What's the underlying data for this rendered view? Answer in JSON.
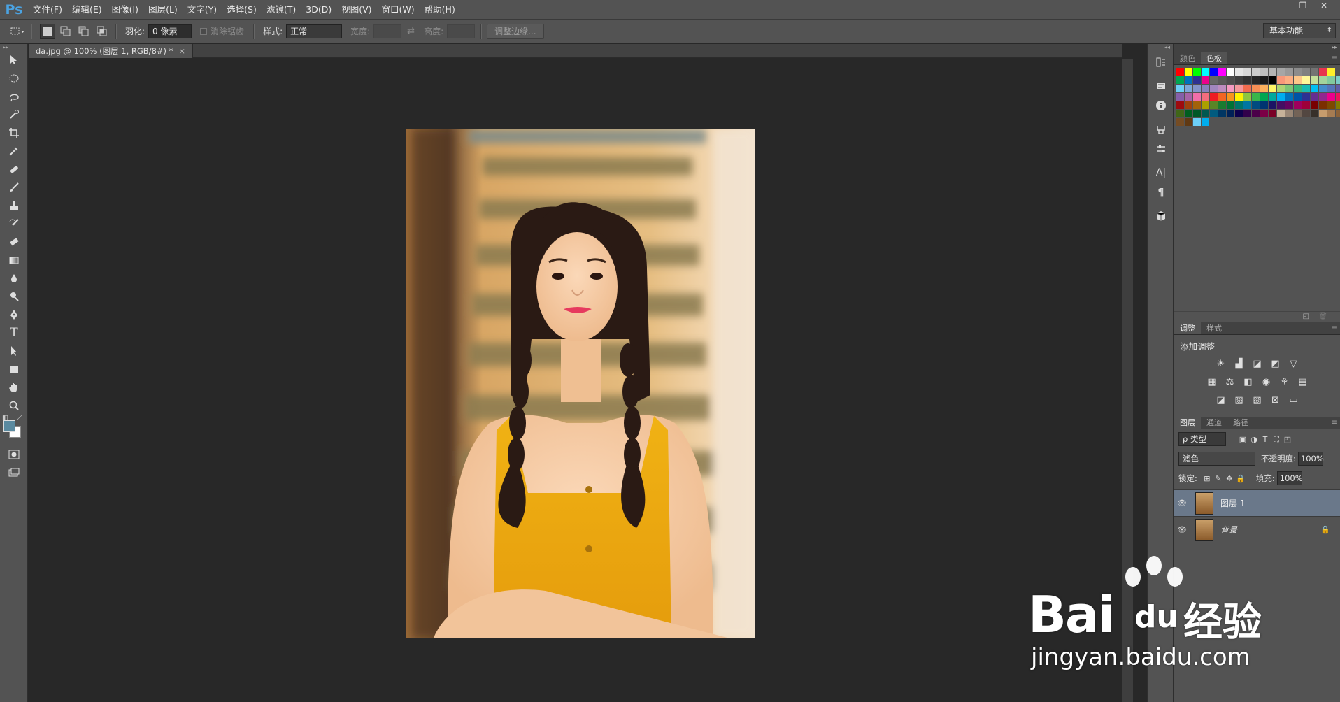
{
  "app": {
    "logo": "Ps"
  },
  "menu": [
    "文件(F)",
    "编辑(E)",
    "图像(I)",
    "图层(L)",
    "文字(Y)",
    "选择(S)",
    "滤镜(T)",
    "3D(D)",
    "视图(V)",
    "窗口(W)",
    "帮助(H)"
  ],
  "window_controls": {
    "minimize": "—",
    "restore": "❐",
    "close": "✕"
  },
  "options": {
    "feather_label": "羽化:",
    "feather_value": "0 像素",
    "antialias_label": "消除锯齿",
    "style_label": "样式:",
    "style_value": "正常",
    "width_label": "宽度:",
    "height_label": "高度:",
    "refine_edge": "调整边缘...",
    "workspace": "基本功能"
  },
  "document_tab": {
    "title": "da.jpg @ 100% (图层 1, RGB/8#) *",
    "close": "×"
  },
  "panels": {
    "color_tabs": [
      "颜色",
      "色板"
    ],
    "adj_tabs": [
      "调整",
      "样式"
    ],
    "adj_title": "添加调整",
    "layer_tabs": [
      "图层",
      "通道",
      "路径"
    ],
    "kind_filter": "ρ 类型",
    "blend_mode": "滤色",
    "opacity_label": "不透明度:",
    "opacity_value": "100%",
    "lock_label": "锁定:",
    "fill_label": "填充:",
    "fill_value": "100%",
    "layers": [
      {
        "name": "图层 1",
        "selected": true
      },
      {
        "name": "背景",
        "selected": false,
        "locked": true
      }
    ]
  },
  "watermark": {
    "brand": "Bai",
    "du": "du",
    "cn": "经验",
    "url": "jingyan.baidu.com"
  },
  "colors": {
    "fg": "#5a8aa0",
    "bg": "#ffffff",
    "selection": "#6a788a",
    "accent": "#4ba3e2"
  }
}
